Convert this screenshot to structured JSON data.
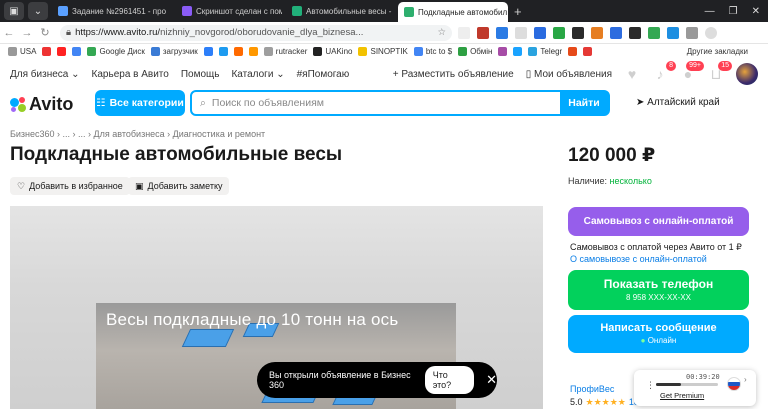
{
  "browser": {
    "tabs": [
      {
        "label": "Задание №2961451 - про",
        "color": "#5aa0ff",
        "active": false
      },
      {
        "label": "Скриншот сделан с помо",
        "color": "#8a5cf6",
        "active": false
      },
      {
        "label": "Автомобильные весы - К",
        "color": "#21b07a",
        "active": false
      },
      {
        "label": "Подкладные автомобил",
        "color": "#2eaf6e",
        "active": true
      }
    ],
    "url_host": "https://www.avito.ru/",
    "url_path": "nizhniy_novgorod/oborudovanie_dlya_biznesa...",
    "bookmarks": [
      {
        "label": "USA",
        "color": "#999"
      },
      {
        "label": "",
        "color": "#e33"
      },
      {
        "label": "",
        "color": "#f22"
      },
      {
        "label": "",
        "color": "#4285f4"
      },
      {
        "label": "Google Диск",
        "color": "#34a853"
      },
      {
        "label": "загрузчик",
        "color": "#3a7bd5"
      },
      {
        "label": "",
        "color": "#2d7ff9"
      },
      {
        "label": "",
        "color": "#1d9bf0"
      },
      {
        "label": "",
        "color": "#ff6a00"
      },
      {
        "label": "",
        "color": "#ff9800"
      },
      {
        "label": "rutracker",
        "color": "#9e9e9e"
      },
      {
        "label": "UAKino",
        "color": "#222"
      },
      {
        "label": "SINOPTIK",
        "color": "#f2c200"
      },
      {
        "label": "btc to $",
        "color": "#4285f4"
      },
      {
        "label": "Обмін",
        "color": "#2ea043"
      },
      {
        "label": "",
        "color": "#a64ca6"
      },
      {
        "label": "",
        "color": "#1aa3ff"
      },
      {
        "label": "Telegr",
        "color": "#2aa3df"
      },
      {
        "label": "",
        "color": "#e64a19"
      },
      {
        "label": "",
        "color": "#e53935"
      }
    ],
    "other_bookmarks": "Другие закладки"
  },
  "avito": {
    "nav": {
      "business": "Для бизнеса",
      "career": "Карьера в Авито",
      "help": "Помощь",
      "catalogs": "Каталоги",
      "helping": "#яПомогаю",
      "post_ad": "Разместить объявление",
      "my_ads": "Мои объявления",
      "badge_fav": "",
      "badge_notif": "8",
      "badge_msg": "99+",
      "badge_cart": "15"
    },
    "logo": "Avito",
    "all_categories": "Все категории",
    "search_placeholder": "Поиск по объявлениям",
    "search_button": "Найти",
    "region": "Алтайский край",
    "breadcrumbs": "Бизнес360 › ... › ... › Для автобизнеса › Диагностика и ремонт",
    "title": "Подкладные автомобильные весы",
    "add_favorite": "Добавить в избранное",
    "add_note": "Добавить заметку",
    "photo_caption": "Весы подкладные до 10 тонн на ось",
    "toast": {
      "text": "Вы открыли объявление в Бизнес 360",
      "what": "Что это?"
    },
    "price": "120 000 ₽",
    "availability_label": "Наличие:",
    "availability_value": "несколько",
    "pickup_button": "Самовывоз с онлайн-оплатой",
    "pickup_note": "Самовывоз с оплатой через Авито от 1 ₽",
    "pickup_link": "О самовывозе с онлайн-оплатой",
    "show_phone": "Показать телефон",
    "phone_masked": "8 958 XXX-XX-XX",
    "write_message": "Написать сообщение",
    "online_status": "Онлайн",
    "seller_name": "ПрофиВес",
    "seller_rating": "5.0",
    "seller_reviews": "18 отзывов"
  },
  "recorder": {
    "time": "00:39:20",
    "premium": "Get Premium"
  },
  "colors": {
    "avito_blue": "#00aaff",
    "pickup_purple": "#965eeb",
    "phone_green": "#02d15c",
    "message_blue": "#00aaff"
  }
}
